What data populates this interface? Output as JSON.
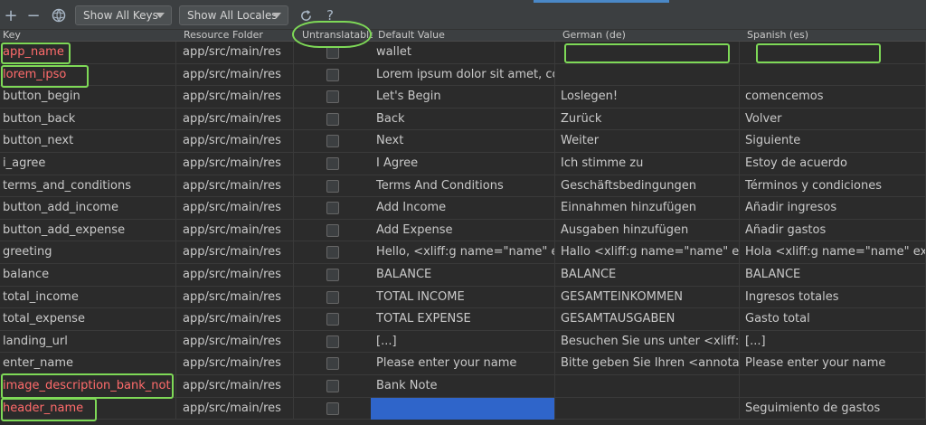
{
  "colors": {
    "accent": "#4a88c7",
    "highlight": "#7ed957",
    "missing_key": "#ff6b6b",
    "selected_cell": "#2f65ca"
  },
  "toolbar": {
    "add_icon": "plus-icon",
    "remove_icon": "minus-icon",
    "globe_icon": "globe-icon",
    "keys_filter": "Show All Keys",
    "locales_filter": "Show All Locales",
    "reload_icon": "reload-icon",
    "help_icon": "help-icon"
  },
  "columns": [
    "Key",
    "Resource Folder",
    "Untranslatable",
    "Default Value",
    "German (de)",
    "Spanish (es)"
  ],
  "rows": [
    {
      "key": "app_name",
      "folder": "app/src/main/res",
      "default": "wallet",
      "de": "",
      "es": "",
      "missing": true
    },
    {
      "key": "lorem_ipso",
      "folder": "app/src/main/res",
      "default": "Lorem ipsum dolor sit amet, co",
      "de": "",
      "es": "",
      "missing": true
    },
    {
      "key": "button_begin",
      "folder": "app/src/main/res",
      "default": "Let's Begin",
      "de": "Loslegen!",
      "es": "comencemos"
    },
    {
      "key": "button_back",
      "folder": "app/src/main/res",
      "default": "Back",
      "de": "Zurück",
      "es": "Volver"
    },
    {
      "key": "button_next",
      "folder": "app/src/main/res",
      "default": "Next",
      "de": "Weiter",
      "es": "Siguiente"
    },
    {
      "key": "i_agree",
      "folder": "app/src/main/res",
      "default": "I Agree",
      "de": "Ich stimme zu",
      "es": "Estoy de acuerdo"
    },
    {
      "key": "terms_and_conditions",
      "folder": "app/src/main/res",
      "default": "Terms And Conditions",
      "de": "Geschäftsbedingungen",
      "es": "Términos y condiciones"
    },
    {
      "key": "button_add_income",
      "folder": "app/src/main/res",
      "default": "Add Income",
      "de": "Einnahmen hinzufügen",
      "es": "Añadir ingresos"
    },
    {
      "key": "button_add_expense",
      "folder": "app/src/main/res",
      "default": "Add Expense",
      "de": "Ausgaben hinzufügen",
      "es": "Añadir gastos"
    },
    {
      "key": "greeting",
      "folder": "app/src/main/res",
      "default": "Hello, <xliff:g name=\"name\" e",
      "de": "Hallo <xliff:g name=\"name\" ex",
      "es": "Hola <xliff:g name=\"name\" ex"
    },
    {
      "key": "balance",
      "folder": "app/src/main/res",
      "default": "BALANCE",
      "de": "BALANCE",
      "es": "BALANCE"
    },
    {
      "key": "total_income",
      "folder": "app/src/main/res",
      "default": "TOTAL INCOME",
      "de": "GESAMTEINKOMMEN",
      "es": "Ingresos totales"
    },
    {
      "key": "total_expense",
      "folder": "app/src/main/res",
      "default": "TOTAL EXPENSE",
      "de": "GESAMTAUSGABEN",
      "es": "Gasto total"
    },
    {
      "key": "landing_url",
      "folder": "app/src/main/res",
      "default": "[...]",
      "de": "Besuchen Sie uns unter <xliff:g",
      "es": "[...]"
    },
    {
      "key": "enter_name",
      "folder": "app/src/main/res",
      "default": "Please enter your name",
      "de": "Bitte geben Sie Ihren <annotat",
      "es": "Please enter your name"
    },
    {
      "key": "image_description_bank_not",
      "folder": "app/src/main/res",
      "default": "Bank Note",
      "de": "",
      "es": "",
      "missing": true
    },
    {
      "key": "header_name",
      "folder": "app/src/main/res",
      "default": "",
      "de": "",
      "es": "Seguimiento de gastos",
      "missing": true
    }
  ]
}
